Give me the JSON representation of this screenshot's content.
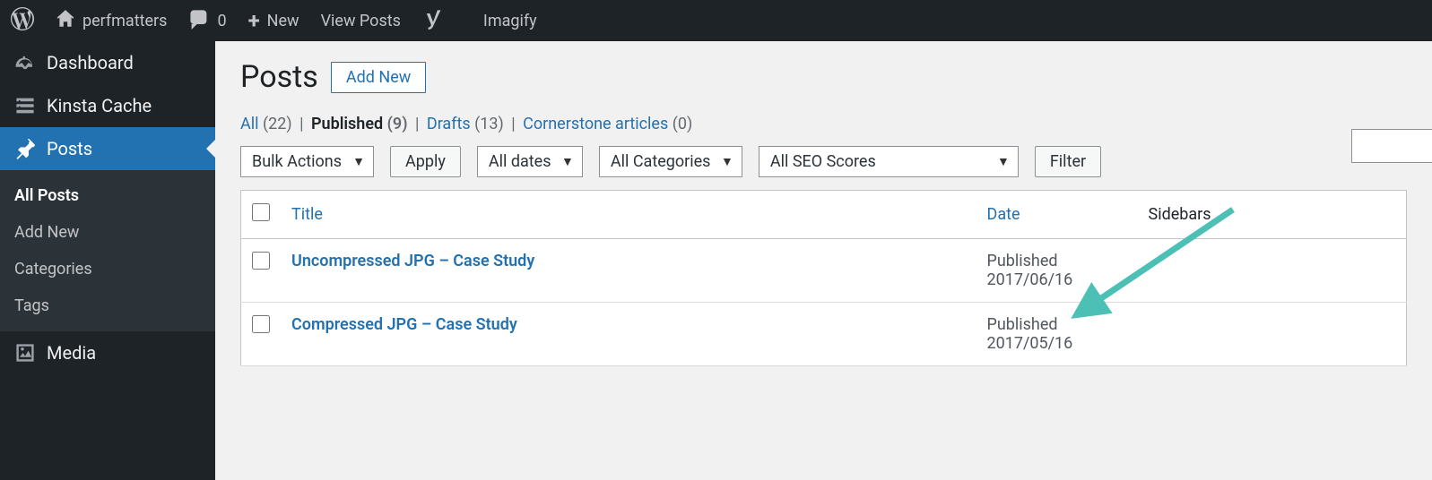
{
  "adminbar": {
    "site_name": "perfmatters",
    "comment_count": "0",
    "new_label": "New",
    "view_posts": "View Posts",
    "imagify": "Imagify"
  },
  "sidebar": {
    "dashboard": "Dashboard",
    "kinsta": "Kinsta Cache",
    "posts": "Posts",
    "media": "Media",
    "submenu": {
      "all_posts": "All Posts",
      "add_new": "Add New",
      "categories": "Categories",
      "tags": "Tags"
    }
  },
  "page": {
    "title": "Posts",
    "add_new": "Add New"
  },
  "filters_nav": {
    "all_label": "All",
    "all_count": "(22)",
    "published_label": "Published",
    "published_count": "(9)",
    "drafts_label": "Drafts",
    "drafts_count": "(13)",
    "cornerstone_label": "Cornerstone articles",
    "cornerstone_count": "(0)"
  },
  "selects": {
    "bulk": "Bulk Actions",
    "dates": "All dates",
    "categories": "All Categories",
    "seo": "All SEO Scores"
  },
  "buttons": {
    "apply": "Apply",
    "filter": "Filter"
  },
  "table": {
    "headers": {
      "title": "Title",
      "date": "Date",
      "sidebars": "Sidebars"
    },
    "rows": [
      {
        "title": "Uncompressed JPG – Case Study",
        "status": "Published",
        "date": "2017/06/16"
      },
      {
        "title": "Compressed JPG – Case Study",
        "status": "Published",
        "date": "2017/05/16"
      }
    ]
  }
}
